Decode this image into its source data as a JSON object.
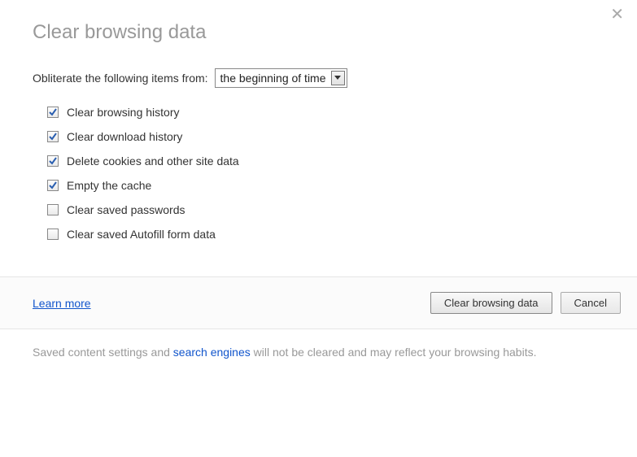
{
  "dialog": {
    "title": "Clear browsing data",
    "prompt_label": "Obliterate the following items from:",
    "time_range_selected": "the beginning of time",
    "options": [
      {
        "label": "Clear browsing history",
        "checked": true
      },
      {
        "label": "Clear download history",
        "checked": true
      },
      {
        "label": "Delete cookies and other site data",
        "checked": true
      },
      {
        "label": "Empty the cache",
        "checked": true
      },
      {
        "label": "Clear saved passwords",
        "checked": false
      },
      {
        "label": "Clear saved Autofill form data",
        "checked": false
      }
    ],
    "learn_more_label": "Learn more",
    "primary_button_label": "Clear browsing data",
    "cancel_button_label": "Cancel",
    "note_prefix": "Saved content settings and ",
    "note_link": "search engines",
    "note_suffix": " will not be cleared and may reflect your browsing habits."
  }
}
